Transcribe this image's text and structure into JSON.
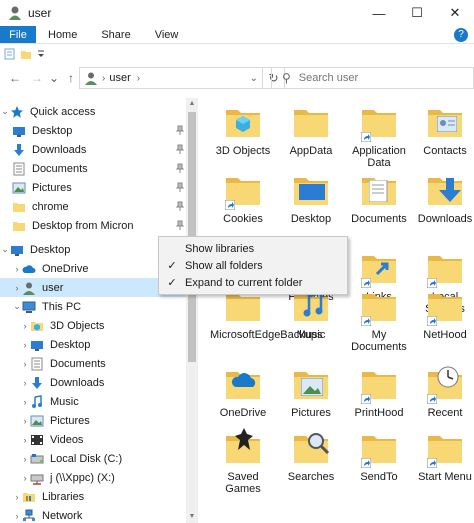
{
  "window": {
    "title": "user",
    "minimize": "—",
    "maximize": "☐",
    "close": "✕"
  },
  "ribbon": {
    "tabs": [
      "File",
      "Home",
      "Share",
      "View"
    ],
    "help": "?"
  },
  "address": {
    "back": "←",
    "forward": "→",
    "recent": "⌄",
    "up": "↑",
    "segment": "user",
    "sep": "›",
    "refresh": "↻"
  },
  "search": {
    "placeholder": "Search user",
    "glyph": "⚲"
  },
  "nav": {
    "items": [
      {
        "label": "Quick access",
        "icon": "star-icon"
      },
      {
        "label": "Desktop",
        "icon": "desktop-folder-icon"
      },
      {
        "label": "Downloads",
        "icon": "download-icon"
      },
      {
        "label": "Documents",
        "icon": "documents-icon"
      },
      {
        "label": "Pictures",
        "icon": "pictures-icon"
      },
      {
        "label": "chrome",
        "icon": "folder-icon"
      },
      {
        "label": "Desktop from Micron",
        "icon": "folder-icon"
      },
      {
        "label": "Desktop",
        "icon": "desktop-icon"
      },
      {
        "label": "OneDrive",
        "icon": "cloud-icon"
      },
      {
        "label": "user",
        "icon": "user-icon"
      },
      {
        "label": "This PC",
        "icon": "pc-icon"
      },
      {
        "label": "3D Objects",
        "icon": "cube-icon"
      },
      {
        "label": "Desktop",
        "icon": "desktop-folder-icon"
      },
      {
        "label": "Documents",
        "icon": "documents-icon"
      },
      {
        "label": "Downloads",
        "icon": "download-icon"
      },
      {
        "label": "Music",
        "icon": "music-icon"
      },
      {
        "label": "Pictures",
        "icon": "pictures-icon"
      },
      {
        "label": "Videos",
        "icon": "video-icon"
      },
      {
        "label": "Local Disk (C:)",
        "icon": "disk-icon"
      },
      {
        "label": "j (\\\\Xppc) (X:)",
        "icon": "network-drive-icon"
      },
      {
        "label": "Libraries",
        "icon": "libraries-icon"
      },
      {
        "label": "Network",
        "icon": "network-icon"
      }
    ]
  },
  "files": [
    "3D Objects",
    "AppData",
    "Application Data",
    "Contacts",
    "Cookies",
    "Desktop",
    "Documents",
    "Downloads",
    "Favorites",
    "Links",
    "Local Settings",
    "MicrosoftEdgeBackups",
    "Music",
    "My Documents",
    "NetHood",
    "OneDrive",
    "Pictures",
    "PrintHood",
    "Recent",
    "Saved Games",
    "Searches",
    "SendTo",
    "Start Menu"
  ],
  "context_menu": {
    "items": [
      {
        "label": "Show libraries",
        "checked": ""
      },
      {
        "label": "Show all folders",
        "checked": "✓"
      },
      {
        "label": "Expand to current folder",
        "checked": "✓"
      }
    ]
  },
  "colors": {
    "accent": "#1979ca",
    "selection": "#cce8ff",
    "folder": "#f8d775",
    "folder_dark": "#e8b949"
  }
}
